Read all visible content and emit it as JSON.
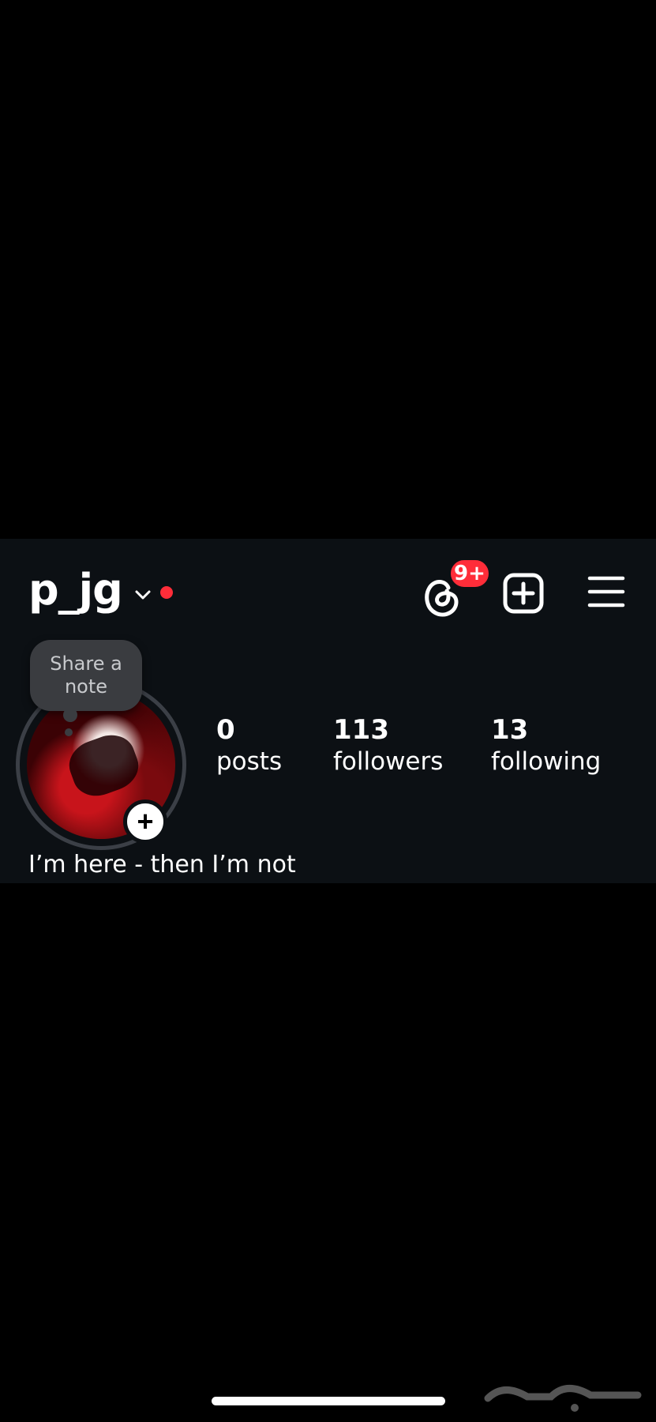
{
  "profile": {
    "username": "p_jg",
    "bio": "I’m here - then I’m not"
  },
  "header": {
    "threads_badge": "9+"
  },
  "note": {
    "label": "Share a note"
  },
  "stats": [
    {
      "number": "0",
      "label": "posts"
    },
    {
      "number": "113",
      "label": "followers"
    },
    {
      "number": "13",
      "label": "following"
    }
  ],
  "add_story": "+",
  "colors": {
    "background": "#000000",
    "panel": "#0c1014",
    "notification": "#ff2d39",
    "note_bubble": "#3a3c40"
  },
  "icons": [
    "chevron-down-icon",
    "threads-icon",
    "create-post-icon",
    "menu-icon"
  ]
}
